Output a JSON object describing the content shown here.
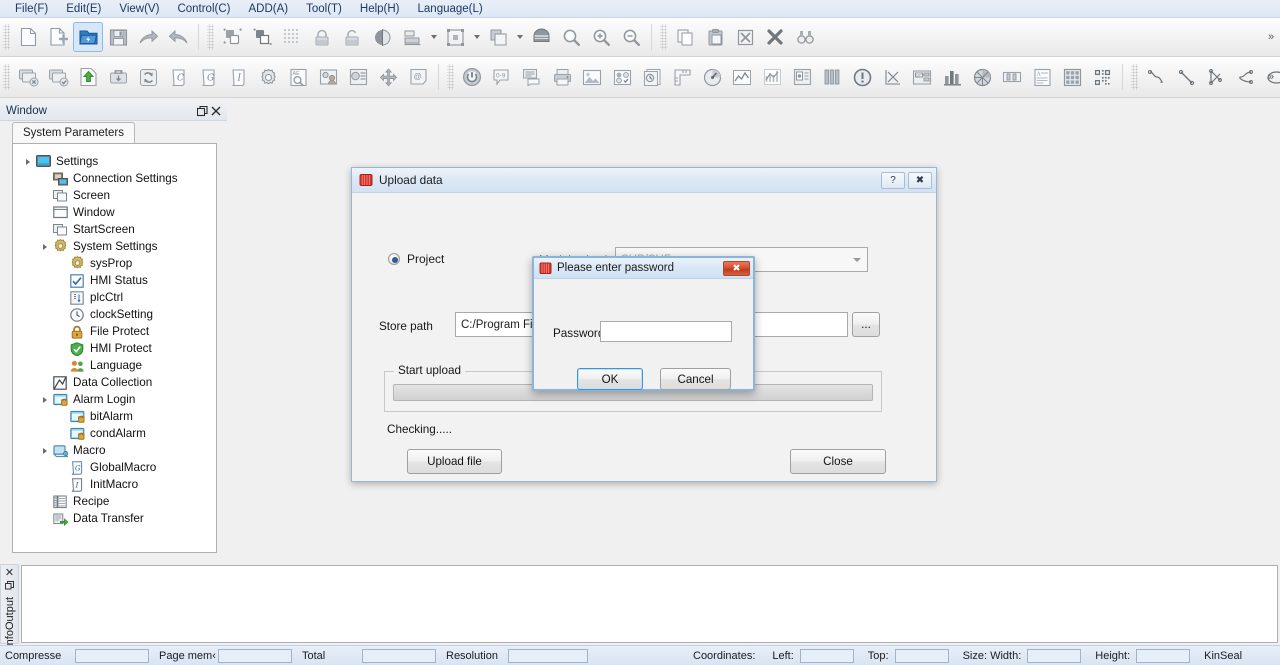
{
  "menubar": {
    "items": [
      {
        "label": "File(F)",
        "name": "menu-file"
      },
      {
        "label": "Edit(E)",
        "name": "menu-edit"
      },
      {
        "label": "View(V)",
        "name": "menu-view"
      },
      {
        "label": "Control(C)",
        "name": "menu-control"
      },
      {
        "label": "ADD(A)",
        "name": "menu-add"
      },
      {
        "label": "Tool(T)",
        "name": "menu-tool"
      },
      {
        "label": "Help(H)",
        "name": "menu-help"
      },
      {
        "label": "Language(L)",
        "name": "menu-language"
      }
    ]
  },
  "toolbar1": {
    "overflow": "»",
    "items": [
      {
        "icon": "new-file-icon"
      },
      {
        "icon": "new-file-add-icon"
      },
      {
        "icon": "open-project-icon"
      },
      {
        "icon": "save-icon"
      },
      {
        "icon": "redo-icon"
      },
      {
        "icon": "undo-icon"
      },
      {
        "icon": "separator"
      },
      {
        "icon": "bring-to-front-icon"
      },
      {
        "icon": "send-to-back-icon"
      },
      {
        "icon": "grid-icon"
      },
      {
        "icon": "lock-icon"
      },
      {
        "icon": "unlock-icon"
      },
      {
        "icon": "mirror-icon"
      },
      {
        "icon": "align-icon",
        "dropdown": true
      },
      {
        "icon": "size-icon",
        "dropdown": true
      },
      {
        "icon": "layer-icon",
        "dropdown": true
      },
      {
        "icon": "shape-icon"
      },
      {
        "icon": "zoom-icon"
      },
      {
        "icon": "zoom-in-icon"
      },
      {
        "icon": "zoom-out-icon"
      },
      {
        "icon": "separator"
      },
      {
        "icon": "copy-icon"
      },
      {
        "icon": "paste-icon"
      },
      {
        "icon": "cut-icon"
      },
      {
        "icon": "delete-icon"
      },
      {
        "icon": "find-icon"
      }
    ]
  },
  "toolbar2": {
    "overflow": "»",
    "items": [
      {
        "icon": "screen-delete-icon"
      },
      {
        "icon": "screen-confirm-icon"
      },
      {
        "icon": "upload-icon"
      },
      {
        "icon": "usb-download-icon"
      },
      {
        "icon": "refresh-icon"
      },
      {
        "icon": "macro-c-icon"
      },
      {
        "icon": "macro-g-icon"
      },
      {
        "icon": "macro-i-icon"
      },
      {
        "icon": "settings-gear-icon"
      },
      {
        "icon": "text-search-icon"
      },
      {
        "icon": "user-window-icon"
      },
      {
        "icon": "screen-preview-icon"
      },
      {
        "icon": "move-icon"
      },
      {
        "icon": "address-tag-icon"
      },
      {
        "icon": "separator"
      },
      {
        "icon": "power-button-icon"
      },
      {
        "icon": "numeric-input-icon"
      },
      {
        "icon": "text-display-icon"
      },
      {
        "icon": "print-icon"
      },
      {
        "icon": "image-icon"
      },
      {
        "icon": "radio-group-icon"
      },
      {
        "icon": "history-icon"
      },
      {
        "icon": "ruler-icon"
      },
      {
        "icon": "gauge-icon"
      },
      {
        "icon": "trend-chart-icon"
      },
      {
        "icon": "line-chart-icon"
      },
      {
        "icon": "alarm-display-icon"
      },
      {
        "icon": "bar-level-icon"
      },
      {
        "icon": "warning-icon"
      },
      {
        "icon": "xy-chart-icon"
      },
      {
        "icon": "data-entry-icon"
      },
      {
        "icon": "bar-chart-icon"
      },
      {
        "icon": "pie-chart-icon"
      },
      {
        "icon": "slider-icon"
      },
      {
        "icon": "text-block-icon"
      },
      {
        "icon": "table-grid-icon"
      },
      {
        "icon": "qr-code-icon"
      },
      {
        "icon": "separator"
      },
      {
        "icon": "polyline-icon"
      },
      {
        "icon": "line-icon"
      },
      {
        "icon": "connector-icon"
      },
      {
        "icon": "curve-icon"
      },
      {
        "icon": "ellipse-icon"
      },
      {
        "icon": "polygon-icon"
      }
    ]
  },
  "dock": {
    "title": "Window",
    "float_icon": "float-icon",
    "close_icon": "close-icon",
    "tab_label": "System Parameters"
  },
  "tree": [
    {
      "label": "Settings",
      "depth": 0,
      "arrow": "open",
      "icon": "monitor-icon"
    },
    {
      "label": "Connection Settings",
      "depth": 1,
      "arrow": "none",
      "icon": "connection-icon"
    },
    {
      "label": "Screen",
      "depth": 1,
      "arrow": "none",
      "icon": "screens-icon"
    },
    {
      "label": "Window",
      "depth": 1,
      "arrow": "none",
      "icon": "window-icon"
    },
    {
      "label": "StartScreen",
      "depth": 1,
      "arrow": "none",
      "icon": "screens-icon"
    },
    {
      "label": "System Settings",
      "depth": 1,
      "arrow": "open",
      "icon": "gear-icon"
    },
    {
      "label": "sysProp",
      "depth": 2,
      "arrow": "none",
      "icon": "gear-icon"
    },
    {
      "label": "HMI Status",
      "depth": 2,
      "arrow": "none",
      "icon": "checkbox-icon"
    },
    {
      "label": "plcCtrl",
      "depth": 2,
      "arrow": "none",
      "icon": "plc-icon"
    },
    {
      "label": "clockSetting",
      "depth": 2,
      "arrow": "none",
      "icon": "clock-icon"
    },
    {
      "label": "File Protect",
      "depth": 2,
      "arrow": "none",
      "icon": "lock-icon"
    },
    {
      "label": "HMI Protect",
      "depth": 2,
      "arrow": "none",
      "icon": "shield-check-icon"
    },
    {
      "label": "Language",
      "depth": 2,
      "arrow": "none",
      "icon": "users-icon"
    },
    {
      "label": "Data Collection",
      "depth": 1,
      "arrow": "none",
      "icon": "data-collection-icon"
    },
    {
      "label": "Alarm Login",
      "depth": 1,
      "arrow": "open",
      "icon": "alarm-icon"
    },
    {
      "label": "bitAlarm",
      "depth": 2,
      "arrow": "none",
      "icon": "alarm-icon"
    },
    {
      "label": "condAlarm",
      "depth": 2,
      "arrow": "none",
      "icon": "alarm-icon"
    },
    {
      "label": "Macro",
      "depth": 1,
      "arrow": "open",
      "icon": "macro-icon"
    },
    {
      "label": "GlobalMacro",
      "depth": 2,
      "arrow": "none",
      "icon": "macro-g-icon"
    },
    {
      "label": "InitMacro",
      "depth": 2,
      "arrow": "none",
      "icon": "macro-i-icon"
    },
    {
      "label": "Recipe",
      "depth": 1,
      "arrow": "none",
      "icon": "recipe-icon"
    },
    {
      "label": "Data Transfer",
      "depth": 1,
      "arrow": "none",
      "icon": "transfer-icon"
    }
  ],
  "upload_dialog": {
    "title": "Upload data",
    "title_icon": "app-icon",
    "help_button": "?",
    "close_button": "✖",
    "project_radio": {
      "label": "Project",
      "selected": true
    },
    "model_selection": {
      "label": "Model selection",
      "value": "SUP/SUF",
      "placeholder": "SUP/SUF"
    },
    "store_path": {
      "label": "Store path",
      "value": "C:/Program Files",
      "browse_label": "..."
    },
    "start_upload": {
      "label": "Start upload",
      "progress_percent": 0
    },
    "status_text": "Checking.....",
    "upload_button": "Upload file",
    "close_action_button": "Close"
  },
  "password_dialog": {
    "title": "Please enter password",
    "title_icon": "app-icon",
    "close_button": "✖",
    "password_label": "Password",
    "password_value": "",
    "ok_button": "OK",
    "cancel_button": "Cancel"
  },
  "output_panel": {
    "close_icon": "close-icon",
    "pin_icon": "pin-icon",
    "label": "InfoOutput"
  },
  "statusbar": {
    "compress_label": "Compresse",
    "page_mem_label": "Page mem‹",
    "total_label": "Total",
    "resolution_label": "Resolution",
    "coordinates_label": "Coordinates:",
    "left_label": "Left:",
    "top_label": "Top:",
    "size_label": "Size: Width:",
    "height_label": "Height:",
    "brand": "KinSeal"
  },
  "colors": {
    "menu_text": "#1f3864",
    "accent_blue": "#2b5c96",
    "close_red": "#c0391c",
    "default_button_border": "#3c93d6"
  }
}
